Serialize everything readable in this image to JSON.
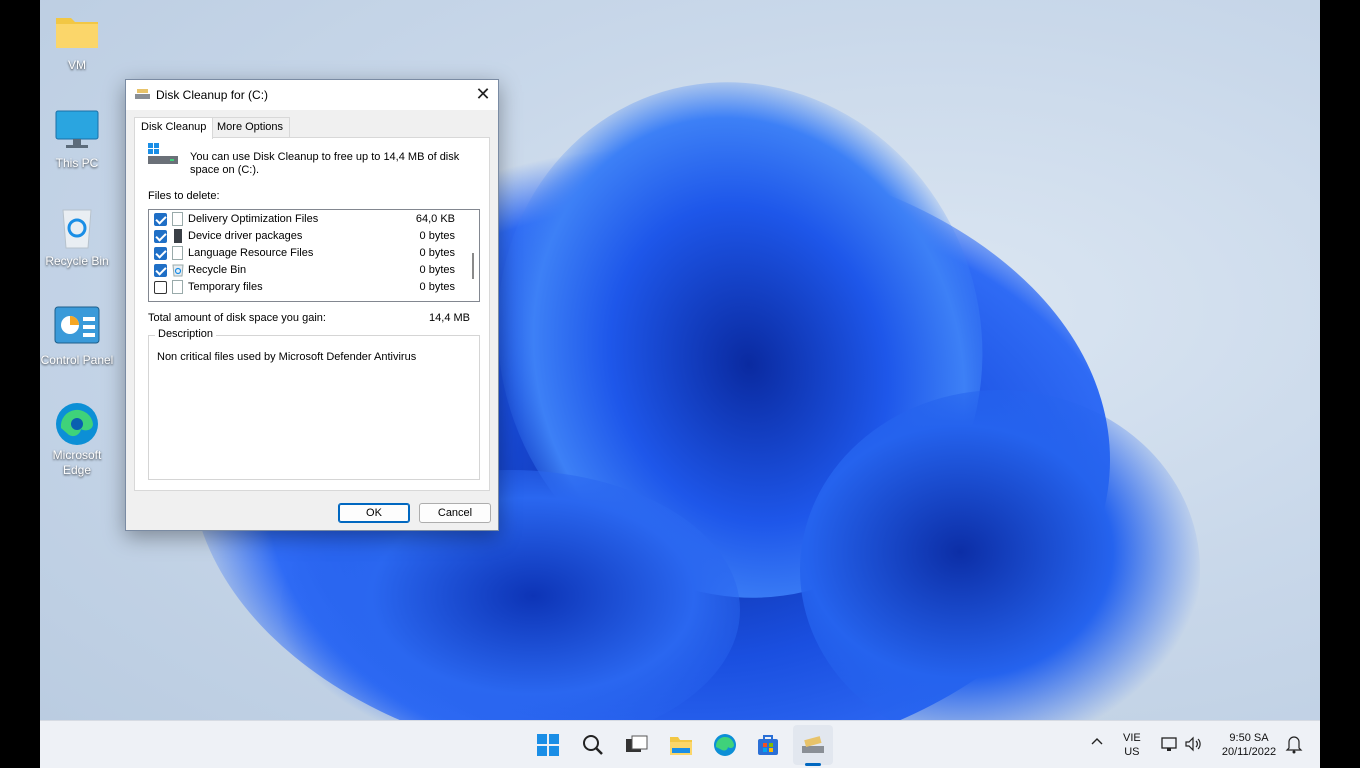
{
  "desktop": {
    "icons": [
      {
        "label": "VM",
        "icon": "folder-icon"
      },
      {
        "label": "This PC",
        "icon": "this-pc-icon"
      },
      {
        "label": "Recycle Bin",
        "icon": "recycle-bin-icon"
      },
      {
        "label": "Control Panel",
        "icon": "control-panel-icon"
      },
      {
        "label": "Microsoft Edge",
        "icon": "edge-icon"
      }
    ]
  },
  "dialog": {
    "title": "Disk Cleanup for  (C:)",
    "close_glyph": "✕",
    "tabs": [
      {
        "label": "Disk Cleanup",
        "active": true
      },
      {
        "label": "More Options",
        "active": false
      }
    ],
    "info_text": "You can use Disk Cleanup to free up to 14,4 MB of disk space on  (C:).",
    "files_to_delete_label": "Files to delete:",
    "files": [
      {
        "name": "Delivery Optimization Files",
        "size": "64,0 KB",
        "checked": true,
        "icon": "file-icon"
      },
      {
        "name": "Device driver packages",
        "size": "0 bytes",
        "checked": true,
        "icon": "driver-icon"
      },
      {
        "name": "Language Resource Files",
        "size": "0 bytes",
        "checked": true,
        "icon": "file-icon"
      },
      {
        "name": "Recycle Bin",
        "size": "0 bytes",
        "checked": true,
        "icon": "recycle-bin-icon"
      },
      {
        "name": "Temporary files",
        "size": "0 bytes",
        "checked": false,
        "icon": "file-icon"
      }
    ],
    "total_label": "Total amount of disk space you gain:",
    "total_value": "14,4 MB",
    "description_legend": "Description",
    "description_text": "Non critical files used by Microsoft Defender Antivirus",
    "ok_label": "OK",
    "cancel_label": "Cancel"
  },
  "taskbar": {
    "apps": [
      "start-icon",
      "search-icon",
      "task-view-icon",
      "file-explorer-icon",
      "edge-icon",
      "store-icon",
      "disk-cleanup-icon"
    ],
    "language_top": "VIE",
    "language_bottom": "US",
    "time": "9:50 SA",
    "date": "20/11/2022"
  },
  "colors": {
    "accent": "#0067c0",
    "checkbox": "#1f6fc6",
    "taskbar_bg": "#eef1f6"
  }
}
